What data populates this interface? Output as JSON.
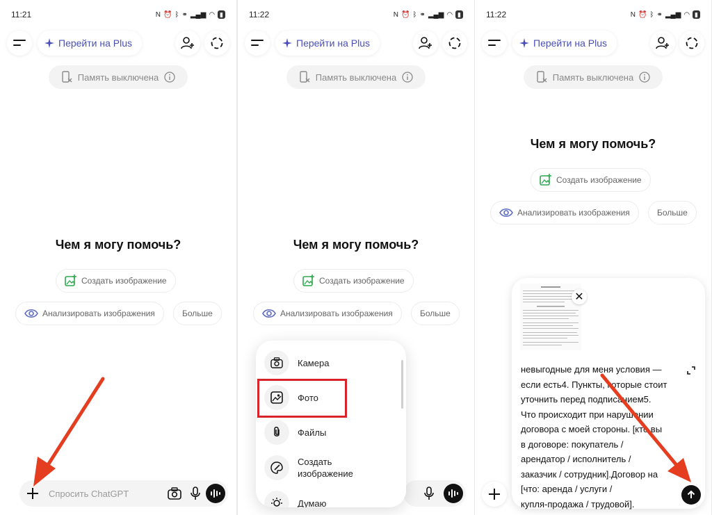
{
  "colors": {
    "accent": "#4a4fb8",
    "arrow": "#e43d20",
    "highlight": "#d8232a",
    "green_icon": "#2fa84f"
  },
  "panels": [
    {
      "time": "11:21",
      "plus_label": "Перейти на Plus",
      "memory_label": "Память выключена",
      "headline": "Чем я могу помочь?",
      "chip_create": "Создать изображение",
      "chip_analyze": "Анализировать изображения",
      "chip_more": "Больше",
      "input_placeholder": "Спросить ChatGPT"
    },
    {
      "time": "11:22",
      "plus_label": "Перейти на Plus",
      "memory_label": "Память выключена",
      "headline": "Чем я могу помочь?",
      "chip_create": "Создать изображение",
      "chip_analyze": "Анализировать изображения",
      "chip_more": "Больше",
      "menu": [
        {
          "label": "Камера",
          "icon": "camera-icon"
        },
        {
          "label": "Фото",
          "icon": "photo-icon"
        },
        {
          "label": "Файлы",
          "icon": "paperclip-icon"
        },
        {
          "label_line1": "Создать",
          "label_line2": "изображение",
          "icon": "palette-icon"
        },
        {
          "label": "Думаю",
          "icon": "lightbulb-icon"
        }
      ]
    },
    {
      "time": "11:22",
      "plus_label": "Перейти на Plus",
      "memory_label": "Память выключена",
      "headline": "Чем я могу помочь?",
      "chip_create": "Создать изображение",
      "chip_analyze": "Анализировать изображения",
      "chip_more": "Больше",
      "compose_lines": [
        "невыгодные для меня условия —",
        "если есть4. Пункты, которые стоит",
        "уточнить перед подписанием5.",
        "Что происходит при нарушении",
        "договора с моей стороны. [кто вы",
        "в договоре: покупатель /",
        "арендатор / исполнитель /",
        "заказчик / сотрудник].Договор на",
        "[что: аренда / услуги /",
        "купля-продажа / трудовой]."
      ]
    }
  ]
}
